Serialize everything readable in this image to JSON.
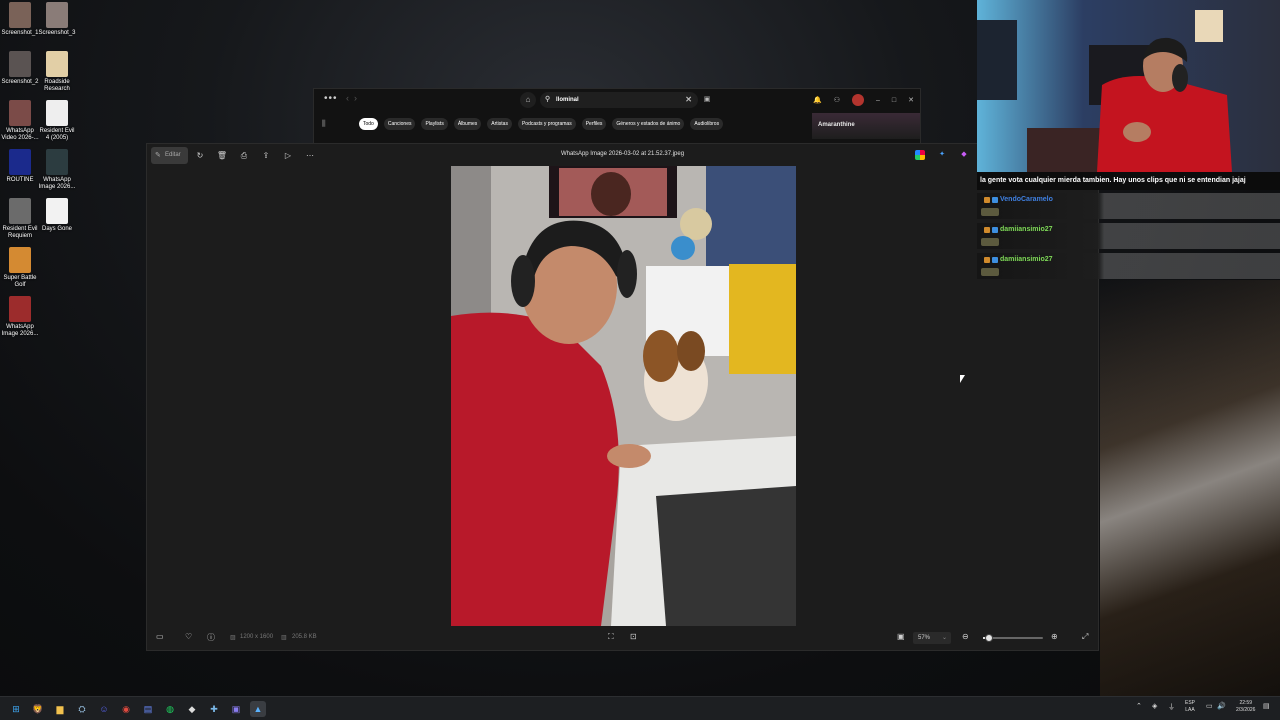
{
  "desktop": {
    "icons": [
      {
        "label": "Screenshot_1",
        "color": "#7a6258"
      },
      {
        "label": "Screenshot_3",
        "color": "#8a7c78"
      },
      {
        "label": "Screenshot_2",
        "color": "#5a5352"
      },
      {
        "label": "Roadside Research",
        "color": "#e2cfa6"
      },
      {
        "label": "WhatsApp Video 2026-...",
        "color": "#7b4b48"
      },
      {
        "label": "Resident Evil 4 (2005)",
        "color": "#eeeeee"
      },
      {
        "label": "ROUTINE",
        "color": "#1b2a8c"
      },
      {
        "label": "WhatsApp Image 2026...",
        "color": "#2c3c40"
      },
      {
        "label": "Resident Evil Requiem",
        "color": "#6b6b6b"
      },
      {
        "label": "Days Gone",
        "color": "#f2f2f2"
      },
      {
        "label": "Super Battle Golf",
        "color": "#d48a32"
      },
      {
        "label": "WhatsApp Image 2026...",
        "color": "#9c2c2c"
      }
    ]
  },
  "spotify": {
    "menu_icon": "more-dots-icon",
    "search_value": "llominal",
    "chips": [
      "Todo",
      "Canciones",
      "Playlists",
      "Álbumes",
      "Artistas",
      "Podcasts y programas",
      "Perfiles",
      "Géneros y estados de ánimo",
      "Audiolibros"
    ],
    "now_playing_title": "Amaranthine",
    "window_controls": {
      "minimize": "–",
      "maximize": "□",
      "close": "✕"
    }
  },
  "photos": {
    "edit_label": "Editar",
    "file_title": "WhatsApp Image 2026-03-02 at 21.52.37.jpeg",
    "dimensions": "1200 x 1600",
    "file_size": "205.8 KB",
    "zoom_level": "57%",
    "zoom_fraction": 0.1,
    "tools": {
      "rotate": "↻",
      "delete": "🗑",
      "print": "⎙",
      "share": "⇪",
      "slideshow": "▷",
      "more": "⋯"
    }
  },
  "chat": {
    "banner": "la gente vota cualquier mierda tambien. Hay unos clips que ni se entendian jajaj",
    "messages": [
      {
        "user": "VendoCaramelo",
        "color": "#3f7fe0"
      },
      {
        "user": "damiiansimio27",
        "color": "#7ed957"
      },
      {
        "user": "damiiansimio27",
        "color": "#7ed957"
      }
    ]
  },
  "taskbar": {
    "apps": [
      "windows-start-icon",
      "brave-icon",
      "file-explorer-icon",
      "steam-icon",
      "discord-icon",
      "chrome-icon",
      "files-icon",
      "spotify-icon",
      "epic-icon",
      "gamepad-icon",
      "app-icon",
      "photos-icon"
    ],
    "lang_top": "ESP",
    "lang_bottom": "LAA",
    "time": "22:59",
    "date": "2/3/2026"
  }
}
